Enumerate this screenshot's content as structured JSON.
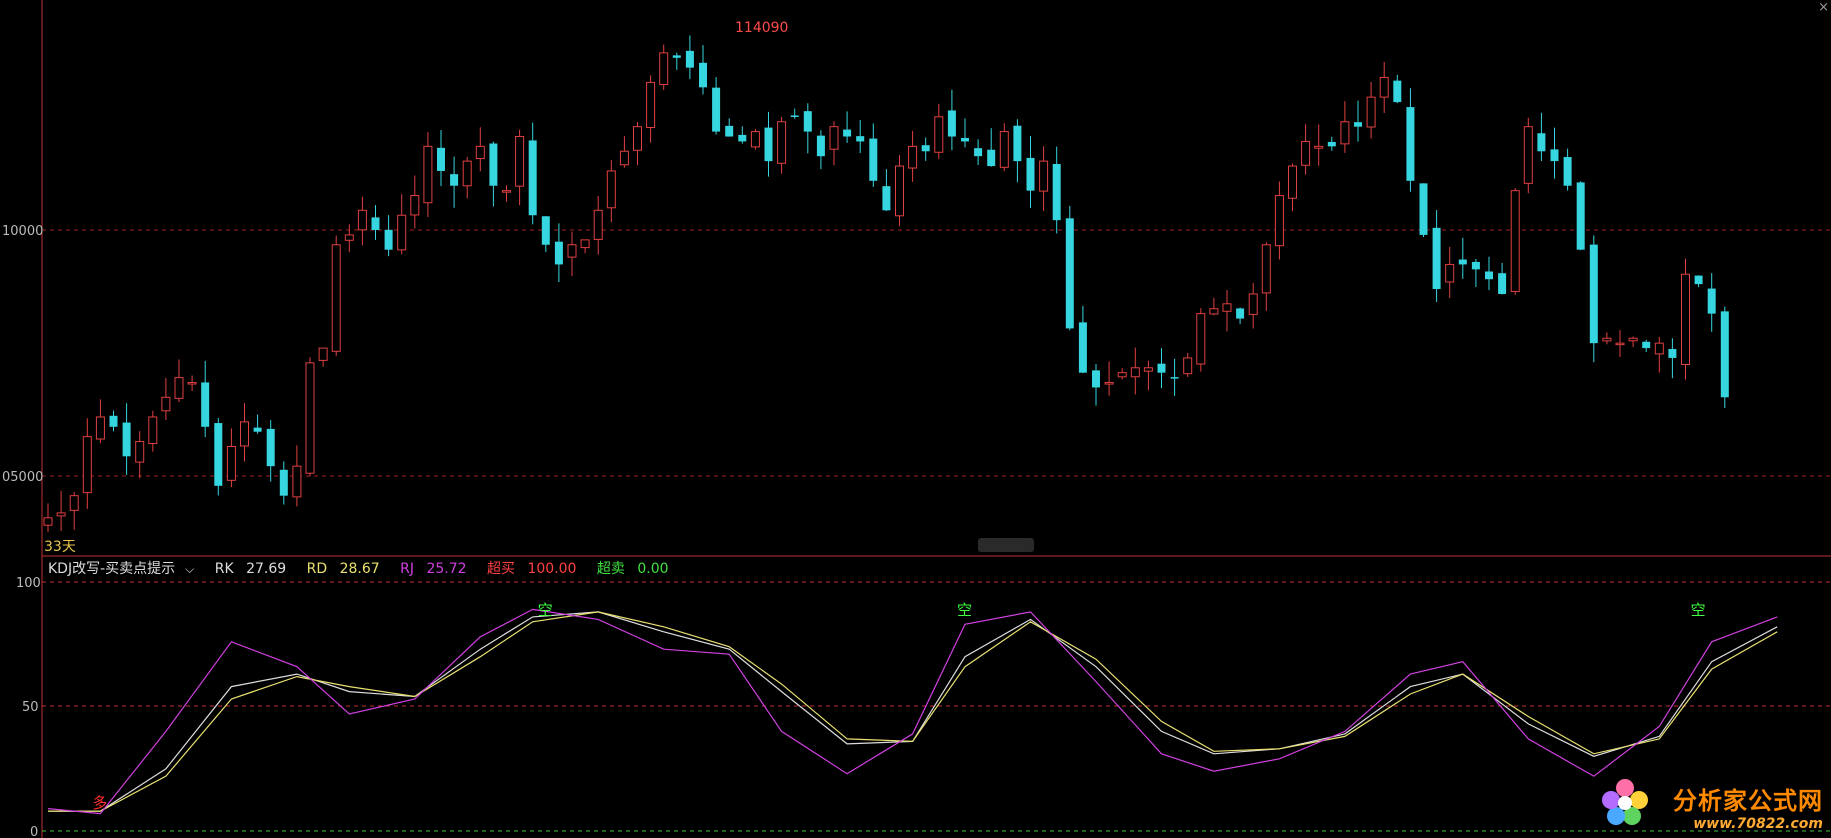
{
  "close_glyph": "×",
  "main_chart": {
    "y_ticks": [
      "10000",
      "05000"
    ],
    "max_label": "114090",
    "days_label": "33天",
    "up_color": "#e04040",
    "down_color": "#35d6e0"
  },
  "indicator": {
    "name": "KDJ改写-买卖点提示",
    "dropdown_glyph": "⌵",
    "rk": {
      "label": "RK",
      "value": "27.69",
      "color": "#dddddd"
    },
    "rd": {
      "label": "RD",
      "value": "28.67",
      "color": "#e8e070"
    },
    "rj": {
      "label": "RJ",
      "value": "25.72",
      "color": "#d040e0"
    },
    "overbuy": {
      "label": "超买",
      "value": "100.00",
      "color": "#ff4040"
    },
    "oversell": {
      "label": "超卖",
      "value": "0.00",
      "color": "#40e040"
    },
    "y_ticks": [
      "100",
      "50",
      "0"
    ],
    "buy_marker": "多",
    "sell_marker": "空"
  },
  "watermark": {
    "brand": "分析家公式网",
    "url": "www.70822.com"
  },
  "chart_data": [
    {
      "type": "candlestick",
      "y_reference_levels": [
        110000,
        105000
      ],
      "max_annotation": 114090,
      "close_path": [
        104150,
        104250,
        104600,
        105800,
        106200,
        106000,
        105400,
        105700,
        106200,
        106600,
        107000,
        106900,
        106000,
        104800,
        105600,
        106100,
        105900,
        105200,
        104600,
        105200,
        107300,
        107600,
        109700,
        109900,
        110400,
        110000,
        109600,
        110300,
        110700,
        111700,
        111200,
        110900,
        111400,
        111700,
        110900,
        110800,
        111900,
        110300,
        109700,
        109300,
        109700,
        109800,
        110400,
        111200,
        111600,
        112100,
        113000,
        113600,
        113500,
        113300,
        112900,
        112000,
        111900,
        111800,
        112000,
        111400,
        112200,
        112300,
        112000,
        111500,
        112100,
        111900,
        111800,
        111000,
        110400,
        111300,
        111700,
        111600,
        112300,
        111900,
        111800,
        111500,
        111300,
        112000,
        111400,
        110800,
        111400,
        110200,
        108000,
        107100,
        106800,
        106900,
        107100,
        107200,
        107200,
        107100,
        107000,
        107400,
        108300,
        108400,
        108500,
        108200,
        108700,
        109700,
        110700,
        111300,
        111800,
        111700,
        111700,
        112200,
        112100,
        112700,
        113100,
        112600,
        111000,
        109900,
        108800,
        109300,
        109300,
        109200,
        109000,
        108700,
        110800,
        112100,
        111600,
        111400,
        110900,
        109600,
        107700,
        107800,
        107700,
        107800,
        107600,
        107700,
        107400,
        109100,
        108900,
        108300,
        106600
      ]
    },
    {
      "type": "line",
      "title": "KDJ改写-买卖点提示",
      "ylim": [
        0,
        100
      ],
      "reference_lines": [
        100,
        50,
        0
      ],
      "series": [
        {
          "name": "RK",
          "color": "#dddddd",
          "x": [
            0,
            4,
            9,
            14,
            19,
            23,
            28,
            33,
            37,
            42,
            47,
            52,
            56,
            61,
            66,
            70,
            75,
            80,
            85,
            89,
            94,
            99,
            104,
            108,
            113,
            118,
            123,
            127,
            132
          ],
          "values": [
            8,
            8,
            25,
            58,
            63,
            56,
            54,
            73,
            86,
            88,
            80,
            73,
            56,
            35,
            36,
            70,
            85,
            66,
            40,
            31,
            33,
            39,
            58,
            63,
            43,
            30,
            38,
            68,
            82
          ]
        },
        {
          "name": "RD",
          "color": "#e8e070",
          "x": [
            0,
            4,
            9,
            14,
            19,
            23,
            28,
            33,
            37,
            42,
            47,
            52,
            56,
            61,
            66,
            70,
            75,
            80,
            85,
            89,
            94,
            99,
            104,
            108,
            113,
            118,
            123,
            127,
            132
          ],
          "values": [
            8,
            8,
            22,
            53,
            62,
            58,
            54,
            70,
            84,
            88,
            82,
            74,
            59,
            37,
            36,
            66,
            84,
            69,
            44,
            32,
            33,
            38,
            55,
            63,
            46,
            31,
            37,
            65,
            80
          ]
        },
        {
          "name": "RJ",
          "color": "#d040e0",
          "x": [
            0,
            4,
            9,
            14,
            19,
            23,
            28,
            33,
            37,
            42,
            47,
            52,
            56,
            61,
            66,
            70,
            75,
            80,
            85,
            89,
            94,
            99,
            104,
            108,
            113,
            118,
            123,
            127,
            132
          ],
          "values": [
            9,
            7,
            40,
            76,
            66,
            47,
            53,
            78,
            89,
            85,
            73,
            71,
            40,
            23,
            39,
            83,
            88,
            60,
            31,
            24,
            29,
            40,
            63,
            68,
            37,
            22,
            42,
            76,
            86
          ]
        }
      ],
      "markers": [
        {
          "label": "多",
          "x": 4
        },
        {
          "label": "空",
          "x": 38
        },
        {
          "label": "空",
          "x": 70
        },
        {
          "label": "空",
          "x": 126
        }
      ]
    }
  ]
}
